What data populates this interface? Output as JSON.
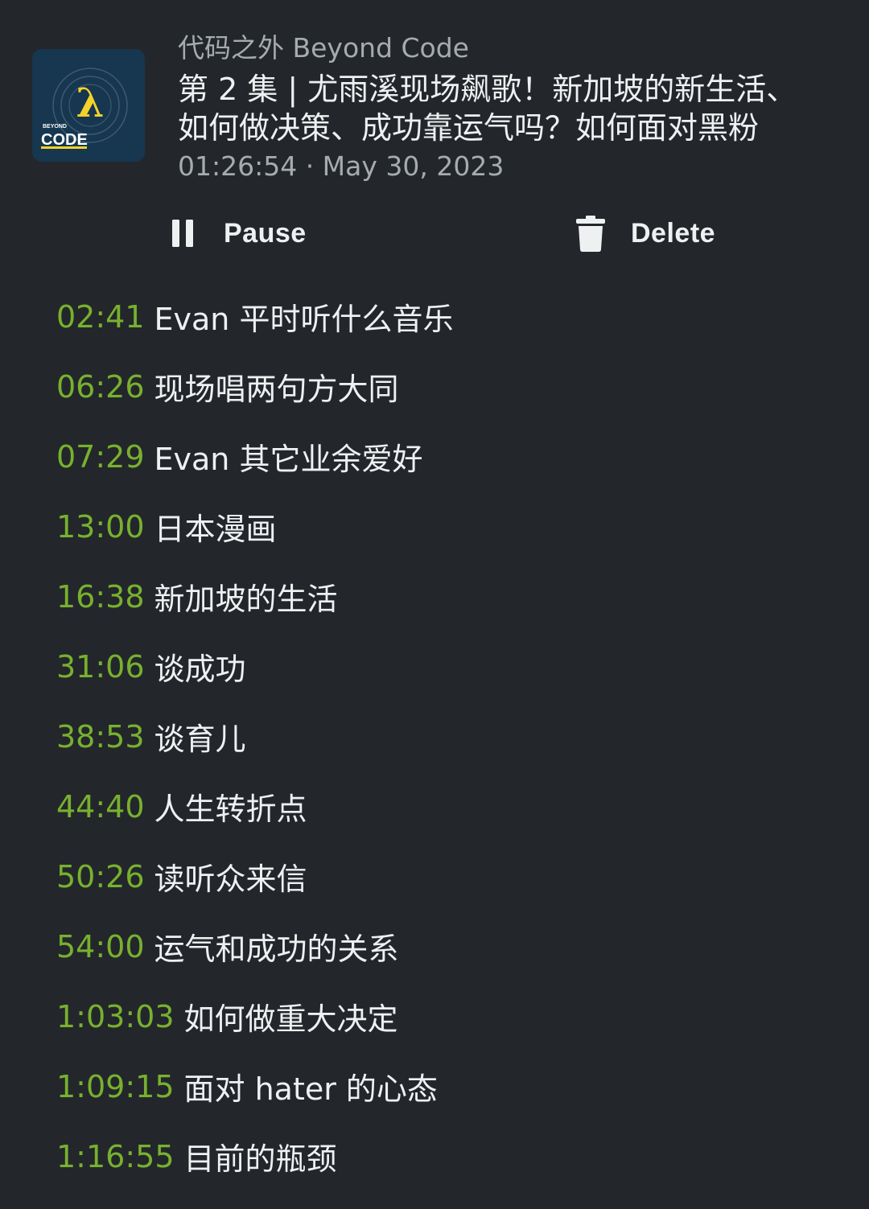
{
  "episode": {
    "podcast": "代码之外 Beyond Code",
    "title": "第 2 集 | 尤雨溪现场飙歌！新加坡的新生活、如何做决策、成功靠运气吗？如何面对黑粉",
    "meta": "01:26:54 · May 30, 2023",
    "artwork": {
      "icon": "lambda-logo",
      "small_text": "BEYOND",
      "big_text": "CODE",
      "lambda": "λ",
      "background": "#17364f",
      "accent": "#f5d22a"
    }
  },
  "actions": {
    "pause": {
      "label": "Pause",
      "icon": "pause-icon"
    },
    "delete": {
      "label": "Delete",
      "icon": "trash-icon"
    }
  },
  "colors": {
    "background": "#23272b",
    "timestamp": "#78b12e",
    "text": "#eef0f2",
    "secondary": "#a6abb0"
  },
  "chapters": [
    {
      "time": "02:41",
      "title": "Evan 平时听什么音乐"
    },
    {
      "time": "06:26",
      "title": "现场唱两句方大同"
    },
    {
      "time": "07:29",
      "title": "Evan 其它业余爱好"
    },
    {
      "time": "13:00",
      "title": "日本漫画"
    },
    {
      "time": "16:38",
      "title": "新加坡的生活"
    },
    {
      "time": "31:06",
      "title": "谈成功"
    },
    {
      "time": "38:53",
      "title": "谈育儿"
    },
    {
      "time": "44:40",
      "title": "人生转折点"
    },
    {
      "time": "50:26",
      "title": "读听众来信"
    },
    {
      "time": "54:00",
      "title": "运气和成功的关系"
    },
    {
      "time": "1:03:03",
      "title": "如何做重大决定"
    },
    {
      "time": "1:09:15",
      "title": "面对 hater 的心态"
    },
    {
      "time": "1:16:55",
      "title": "目前的瓶颈"
    }
  ]
}
